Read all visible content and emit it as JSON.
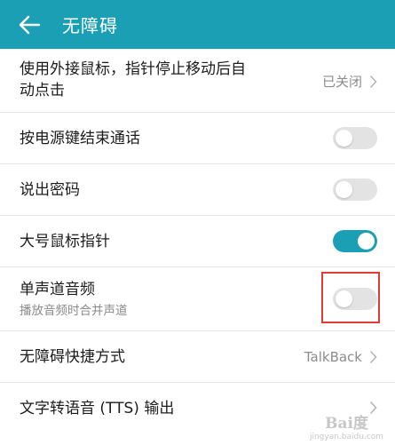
{
  "header": {
    "title": "无障碍",
    "background": "#1a9fb4",
    "back_icon": "arrow-left-icon"
  },
  "rows": [
    {
      "label_line1": "使用外接鼠标，指针停止移动后自",
      "label_line2": "动点击",
      "value": "已关闭",
      "control": "chevron"
    },
    {
      "label": "按电源键结束通话",
      "control": "toggle",
      "state": "off"
    },
    {
      "label": "说出密码",
      "control": "toggle",
      "state": "off"
    },
    {
      "label": "大号鼠标指针",
      "control": "toggle",
      "state": "on"
    },
    {
      "label": "单声道音频",
      "sublabel": "播放音频时合并声道",
      "control": "toggle",
      "state": "off",
      "highlighted": true
    },
    {
      "label": "无障碍快捷方式",
      "value": "TalkBack",
      "control": "chevron"
    },
    {
      "label": "文字转语音 (TTS) 输出",
      "control": "chevron"
    }
  ],
  "colors": {
    "accent": "#1a9fb4",
    "highlight": "#e53935"
  },
  "watermark": {
    "text": "Bai度",
    "sub": "jingyan.baidu.com"
  }
}
